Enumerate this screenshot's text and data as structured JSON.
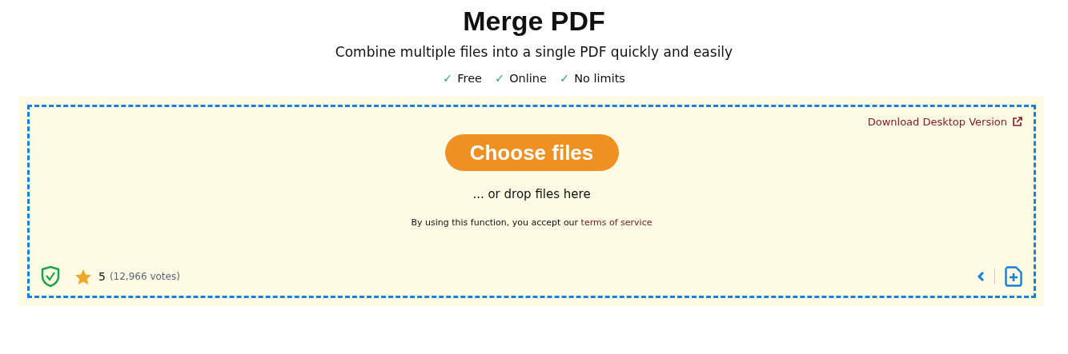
{
  "title": "Merge PDF",
  "subtitle": "Combine multiple files into a single PDF quickly and easily",
  "features": [
    {
      "check": "✓",
      "label": "Free"
    },
    {
      "check": "✓",
      "label": "Online"
    },
    {
      "check": "✓",
      "label": "No limits"
    }
  ],
  "upload": {
    "desktop_link": "Download Desktop Version",
    "button": "Choose files",
    "drop_hint": "... or drop files here",
    "terms_prefix": "By using this function, you accept our ",
    "terms_link": "terms of service",
    "rating": "5",
    "votes": "(12,966 votes)"
  }
}
